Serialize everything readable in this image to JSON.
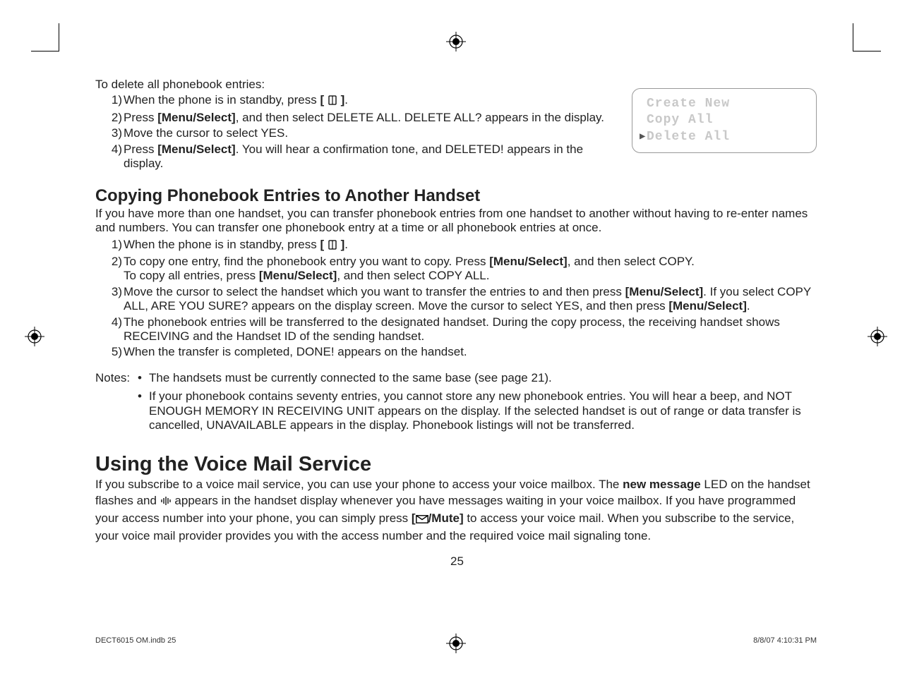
{
  "topcrop": {},
  "intro_delete": "To delete all phonebook entries:",
  "delete_steps": {
    "s1_a": "When the phone is in standby, press ",
    "s1_b": "[ ",
    "s1_c": " ]",
    "s1_d": ".",
    "s2_a": "Press ",
    "s2_b": "[Menu/Select]",
    "s2_c": ", and then select DELETE ALL. DELETE ALL? appears in the display.",
    "s3": "Move the cursor to select YES.",
    "s4_a": "Press ",
    "s4_b": "[Menu/Select]",
    "s4_c": ". You will hear a confirmation tone, and DELETED! appears in the display."
  },
  "screen": {
    "line1": "Create New",
    "line2": "Copy All",
    "line3": "Delete All"
  },
  "copy_heading": "Copying Phonebook Entries to Another Handset",
  "copy_intro": "If you have more than one handset, you can transfer phonebook entries from one handset to another without having to re-enter names and numbers. You can transfer one phonebook entry at a time or all phonebook entries at once.",
  "copy_steps": {
    "s1_a": "When the phone is in standby, press ",
    "s1_b": "[ ",
    "s1_c": " ]",
    "s1_d": ".",
    "s2_a": "To copy one entry, find the phonebook entry you want to copy. Press ",
    "s2_b": "[Menu/Select]",
    "s2_c": ", and then select COPY.",
    "s2_d": "To copy all entries, press ",
    "s2_e": "[Menu/Select]",
    "s2_f": ", and then select COPY ALL.",
    "s3_a": "Move the cursor to select the handset which you want to transfer the entries to and then press ",
    "s3_b": "[Menu/Select]",
    "s3_c": ". If you select COPY ALL, ARE YOU SURE? appears on the display screen. Move the cursor to select YES, and then press ",
    "s3_d": "[Menu/Select]",
    "s3_e": ".",
    "s4": "The phonebook entries will be transferred to the designated handset. During the copy process, the receiving handset shows RECEIVING and the Handset ID of the sending handset.",
    "s5": "When the transfer is completed, DONE! appears on the handset."
  },
  "notes_label": "Notes:",
  "notes": {
    "n1": "The handsets must be currently connected to the same base (see page 21).",
    "n2": "If your phonebook contains seventy entries, you cannot store any new phonebook entries. You will hear a beep, and NOT ENOUGH MEMORY IN RECEIVING UNIT appears on the display. If the selected handset is out of range or data transfer is cancelled, UNAVAILABLE appears in the display. Phonebook listings will not be transferred."
  },
  "vm_heading": "Using the Voice Mail Service",
  "vm_para": {
    "a": "If you subscribe to a voice mail service, you can use your phone to access your voice mailbox. The ",
    "b": "new message",
    "c": " LED on the handset flashes and ",
    "d": " appears in the handset display whenever you have messages waiting in your voice mailbox. If you have programmed your access number into your phone, you can simply press ",
    "e": "[",
    "f": "/Mute]",
    "g": " to access your voice mail. When you subscribe to the service, your voice mail provider provides you with the access number and the required voice mail signaling tone."
  },
  "page_number": "25",
  "footer_left": "DECT6015 OM.indb   25",
  "footer_right": "8/8/07   4:10:31 PM"
}
